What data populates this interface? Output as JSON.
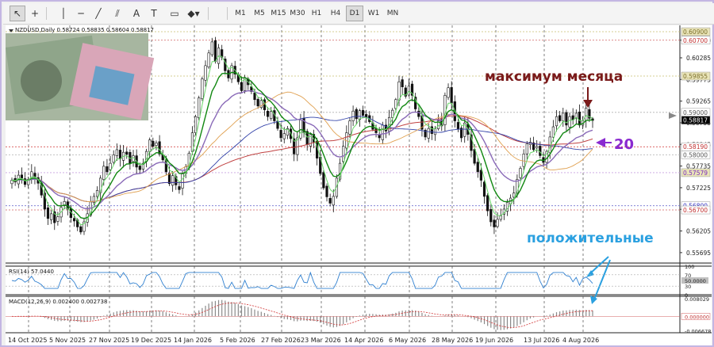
{
  "toolbar": {
    "tools": [
      {
        "icon": "cursor-icon"
      },
      {
        "icon": "crosshair-icon"
      },
      {
        "icon": "vertical-line-icon"
      },
      {
        "icon": "horizontal-line-icon"
      },
      {
        "icon": "trendline-icon"
      },
      {
        "icon": "channel-icon"
      },
      {
        "icon": "text-tool-icon"
      },
      {
        "icon": "text-label-icon"
      },
      {
        "icon": "rectangle-icon"
      },
      {
        "icon": "shapes-dropdown-icon"
      }
    ],
    "timeframes": [
      "M1",
      "M5",
      "M15",
      "M30",
      "H1",
      "H4",
      "D1",
      "W1",
      "MN"
    ],
    "active_timeframe": "D1"
  },
  "chart_data": {
    "type": "candlestick",
    "symbol_info": "NZDUSD,Daily  0.58724 0.58835 0.58604 0.58817",
    "y_ticks": [
      "0.60700",
      "0.60285",
      "0.59775",
      "0.59265",
      "0.58755",
      "0.58245",
      "0.57735",
      "0.57225",
      "0.56715",
      "0.56205",
      "0.55695"
    ],
    "price_boxes": [
      {
        "value": "0.60900",
        "price": 0.609,
        "color": "#e9e4b8",
        "text_color": "#7a6e2a"
      },
      {
        "value": "0.60700",
        "price": 0.607,
        "color": "#ffffff",
        "text_color": "#c03030"
      },
      {
        "value": "0.59855",
        "price": 0.59855,
        "color": "#e9e4b8",
        "text_color": "#7a6e2a"
      },
      {
        "value": "0.59000",
        "price": 0.59,
        "color": "#ffffff",
        "text_color": "#555555"
      },
      {
        "value": "0.58817",
        "price": 0.58817,
        "color": "#000000",
        "text_color": "#ffffff"
      },
      {
        "value": "0.58190",
        "price": 0.5819,
        "color": "#ffffff",
        "text_color": "#c03030"
      },
      {
        "value": "0.58000",
        "price": 0.58,
        "color": "#ffffff",
        "text_color": "#555555"
      },
      {
        "value": "0.57579",
        "price": 0.57579,
        "color": "#e9e4b8",
        "text_color": "#7a2ac0"
      },
      {
        "value": "0.56800",
        "price": 0.568,
        "color": "#ffffff",
        "text_color": "#3030c0"
      },
      {
        "value": "0.56700",
        "price": 0.567,
        "color": "#ffffff",
        "text_color": "#c03030"
      }
    ],
    "x_labels": [
      "14 Oct 2025",
      "5 Nov 2025",
      "27 Nov 2025",
      "19 Dec 2025",
      "14 Jan 2026",
      "5 Feb 2026",
      "27 Feb 2026",
      "23 Mar 2026",
      "14 Apr 2026",
      "6 May 2026",
      "28 May 2026",
      "19 Jun 2026",
      "13 Jul 2026",
      "4 Aug 2026"
    ],
    "y_range": [
      0.5545,
      0.6105
    ],
    "series_closes": [
      0.574,
      0.5736,
      0.5752,
      0.5745,
      0.573,
      0.5742,
      0.576,
      0.5748,
      0.5733,
      0.5705,
      0.5672,
      0.565,
      0.5661,
      0.564,
      0.5654,
      0.5676,
      0.569,
      0.5672,
      0.5652,
      0.5644,
      0.563,
      0.5618,
      0.5642,
      0.5661,
      0.5689,
      0.5702,
      0.5716,
      0.5745,
      0.5773,
      0.576,
      0.578,
      0.58,
      0.5812,
      0.579,
      0.5806,
      0.5801,
      0.578,
      0.5798,
      0.5771,
      0.5765,
      0.578,
      0.5808,
      0.5835,
      0.582,
      0.5828,
      0.5802,
      0.5788,
      0.576,
      0.5732,
      0.5751,
      0.5729,
      0.5718,
      0.5755,
      0.5772,
      0.5804,
      0.5852,
      0.589,
      0.5934,
      0.5979,
      0.601,
      0.604,
      0.6066,
      0.602,
      0.6052,
      0.603,
      0.5998,
      0.5981,
      0.601,
      0.599,
      0.5972,
      0.5951,
      0.5982,
      0.5965,
      0.5949,
      0.593,
      0.5915,
      0.5928,
      0.5906,
      0.589,
      0.5902,
      0.588,
      0.5862,
      0.584,
      0.585,
      0.5862,
      0.5838,
      0.5802,
      0.584,
      0.5882,
      0.5852,
      0.5824,
      0.5848,
      0.583,
      0.5792,
      0.5756,
      0.5722,
      0.5701,
      0.5686,
      0.5702,
      0.5745,
      0.578,
      0.582,
      0.5852,
      0.588,
      0.5903,
      0.5885,
      0.5904,
      0.5893,
      0.5888,
      0.5878,
      0.586,
      0.5852,
      0.584,
      0.587,
      0.5856,
      0.5888,
      0.5905,
      0.593,
      0.5972,
      0.596,
      0.5938,
      0.5962,
      0.594,
      0.5908,
      0.589,
      0.586,
      0.5842,
      0.5862,
      0.585,
      0.5862,
      0.588,
      0.5868,
      0.594,
      0.5958,
      0.5922,
      0.588,
      0.586,
      0.584,
      0.5875,
      0.5848,
      0.581,
      0.578,
      0.576,
      0.574,
      0.5702,
      0.5668,
      0.5642,
      0.563,
      0.5648,
      0.5656,
      0.5672,
      0.5688,
      0.5698,
      0.571,
      0.5742,
      0.5768,
      0.5802,
      0.5826,
      0.583,
      0.5812,
      0.582,
      0.5798,
      0.5782,
      0.5808,
      0.5842,
      0.5866,
      0.589,
      0.588,
      0.5898,
      0.587,
      0.589,
      0.5882,
      0.5898,
      0.587,
      0.588,
      0.591,
      0.5886,
      0.5881
    ],
    "rsi": {
      "label": "RSI(14) 57.0440",
      "ticks": [
        "100",
        "70",
        "50.0000",
        "30",
        "0"
      ],
      "range": [
        0,
        100
      ]
    },
    "macd": {
      "label": "MACD(12,26,9) 0.002400 0.002738",
      "ticks": [
        "0.008029",
        "0.000000",
        "-0.006678"
      ],
      "range": [
        -0.0075,
        0.0092
      ]
    },
    "annotations": {
      "month_max": "максимум месяца",
      "twenty": "20",
      "positive": "положительные"
    },
    "colors": {
      "bull": "#1a1a1a",
      "bear": "#1a1a1a",
      "ma_fast": "#6ad86a",
      "ma_mid": "#118811",
      "ma_slow": "#8a6ab8",
      "ma_orange": "#e0a050",
      "ma_red": "#c04040",
      "ma_blue": "#3040a8",
      "hline_red": "#d03030",
      "annot_dark_red": "#7a1a1a",
      "annot_purple": "#8a2ad0",
      "annot_blue": "#2aa0e0"
    }
  }
}
